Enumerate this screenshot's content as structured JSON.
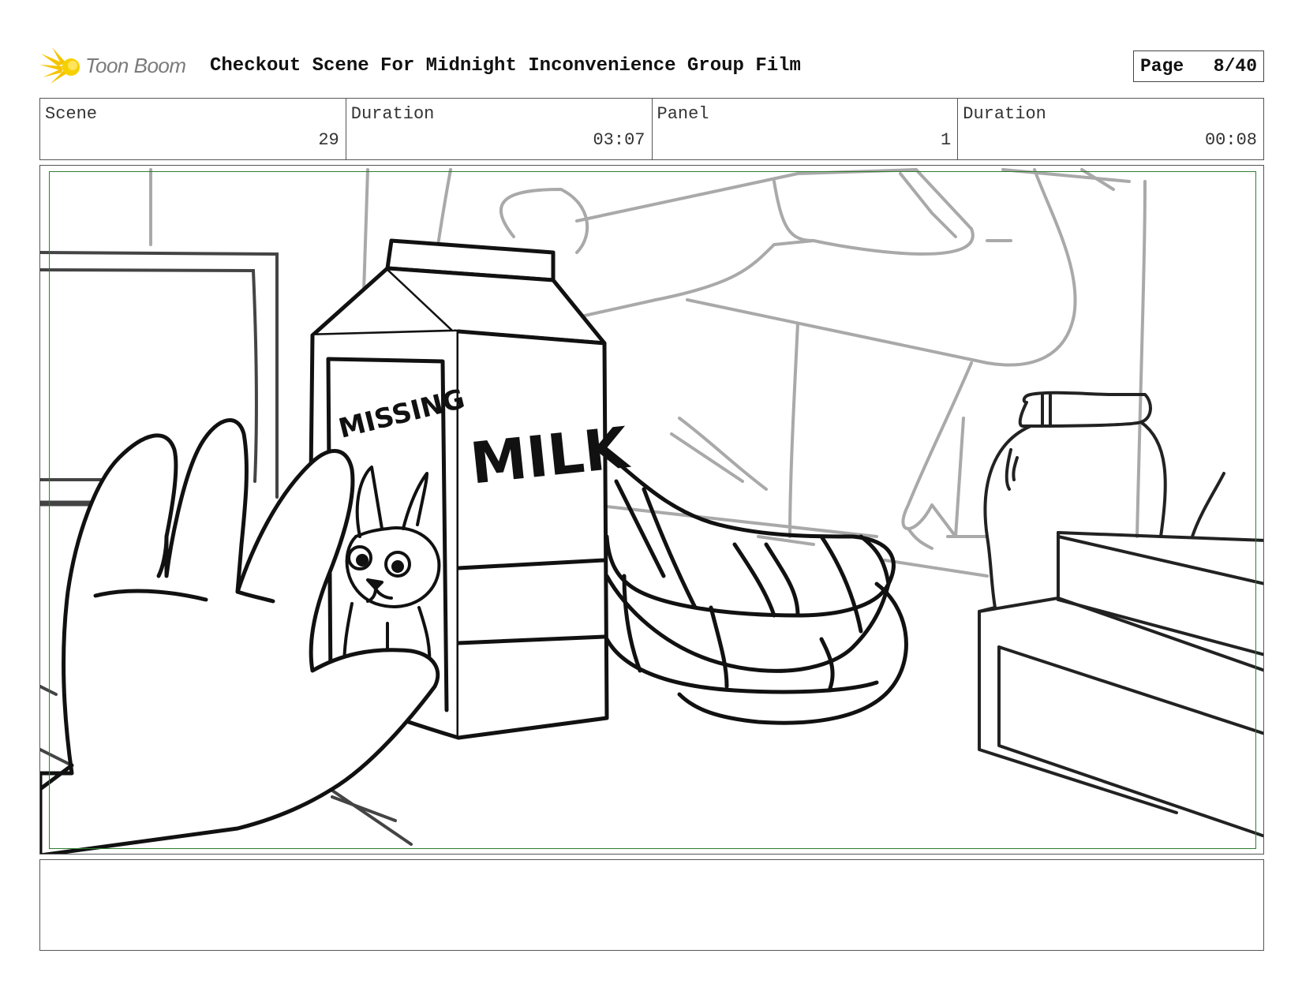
{
  "header": {
    "logo_text": "Toon Boom",
    "title": "Checkout Scene For Midnight Inconvenience Group Film",
    "page_label": "Page",
    "page_value": "8/40"
  },
  "info": {
    "scene_label": "Scene",
    "scene_value": "29",
    "duration_label": "Duration",
    "duration_value": "03:07",
    "panel_label": "Panel",
    "panel_value": "1",
    "panel_duration_label": "Duration",
    "panel_duration_value": "00:08"
  },
  "panel_art": {
    "carton_text_top": "MISSING",
    "carton_text_side": "MILK"
  },
  "notes": {
    "text": ""
  },
  "colors": {
    "safe_frame": "#2e7d32",
    "logo_accent": "#f5c400",
    "line_art": "#111111",
    "background_art": "#a9a9a9"
  },
  "icons": {
    "logo": "toon-boom-logo-icon"
  }
}
